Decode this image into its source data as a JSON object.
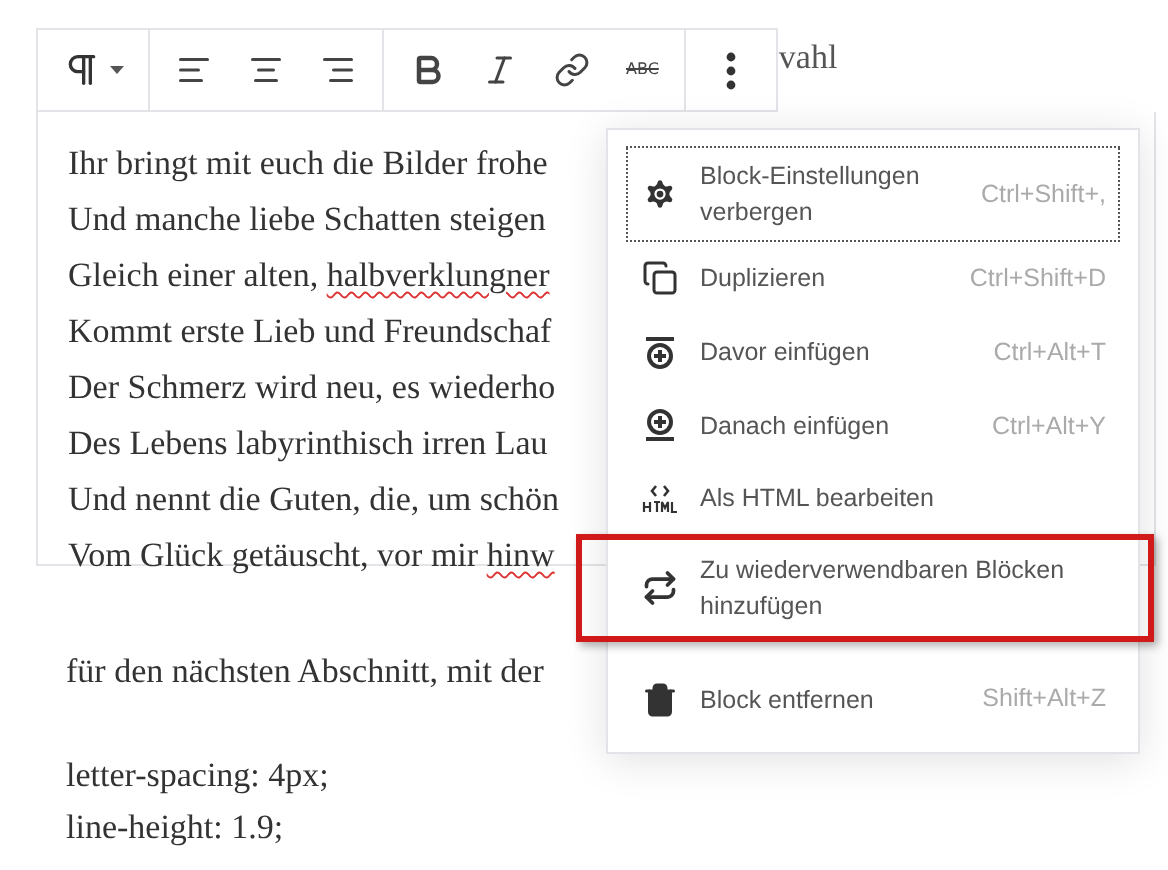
{
  "behind_toolbar_text": "vahl",
  "toolbar": {
    "groups": [
      [
        {
          "kind": "paragraph",
          "dropdown": true
        }
      ],
      [
        {
          "kind": "align-left"
        },
        {
          "kind": "align-center"
        },
        {
          "kind": "align-right"
        }
      ],
      [
        {
          "kind": "bold"
        },
        {
          "kind": "italic"
        },
        {
          "kind": "link"
        },
        {
          "kind": "strike",
          "label": "ABC"
        }
      ],
      [
        {
          "kind": "more"
        }
      ]
    ]
  },
  "block_lines": [
    [
      {
        "text": "Ihr bringt mit euch die Bilder frohe",
        "misspelled": false
      }
    ],
    [
      {
        "text": "Und manche liebe Schatten steigen",
        "misspelled": false
      }
    ],
    [
      {
        "text": "Gleich einer alten, ",
        "misspelled": false
      },
      {
        "text": "halbverklungner",
        "misspelled": true
      }
    ],
    [
      {
        "text": "Kommt erste Lieb und Freundschaf",
        "misspelled": false
      }
    ],
    [
      {
        "text": "Der Schmerz wird neu, es wiederho",
        "misspelled": false
      }
    ],
    [
      {
        "text": "Des Lebens labyrinthisch irren Lau",
        "misspelled": false
      }
    ],
    [
      {
        "text": "Und nennt die Guten, die, um schön",
        "misspelled": false
      }
    ],
    [
      {
        "text": "Vom Glück getäuscht, vor mir ",
        "misspelled": false
      },
      {
        "text": "hinw",
        "misspelled": true
      }
    ]
  ],
  "after_text": "für den nächsten Abschnitt, mit der",
  "code_lines": [
    "letter-spacing: 4px;",
    "line-height: 1.9;"
  ],
  "menu": {
    "groups": [
      [
        {
          "kind": "gear",
          "label": "Block-Einstellungen verbergen",
          "shortcut": "Ctrl+Shift+,",
          "focused": true,
          "highlighted": false
        },
        {
          "kind": "duplicate",
          "label": "Duplizieren",
          "shortcut": "Ctrl+Shift+D",
          "focused": false,
          "highlighted": false
        },
        {
          "kind": "insert-before",
          "label": "Davor einfügen",
          "shortcut": "Ctrl+Alt+T",
          "focused": false,
          "highlighted": false
        },
        {
          "kind": "insert-after",
          "label": "Danach einfügen",
          "shortcut": "Ctrl+Alt+Y",
          "focused": false,
          "highlighted": false
        },
        {
          "kind": "html",
          "label": "Als HTML bearbeiten",
          "focused": false,
          "highlighted": false
        },
        {
          "kind": "reusable",
          "label": "Zu wiederverwendbaren Blöcken hinzufügen",
          "focused": false,
          "highlighted": true
        }
      ],
      [
        {
          "kind": "trash",
          "label": "Block entfernen",
          "shortcut": "Shift+Alt+Z",
          "focused": false,
          "highlighted": false
        }
      ]
    ]
  }
}
